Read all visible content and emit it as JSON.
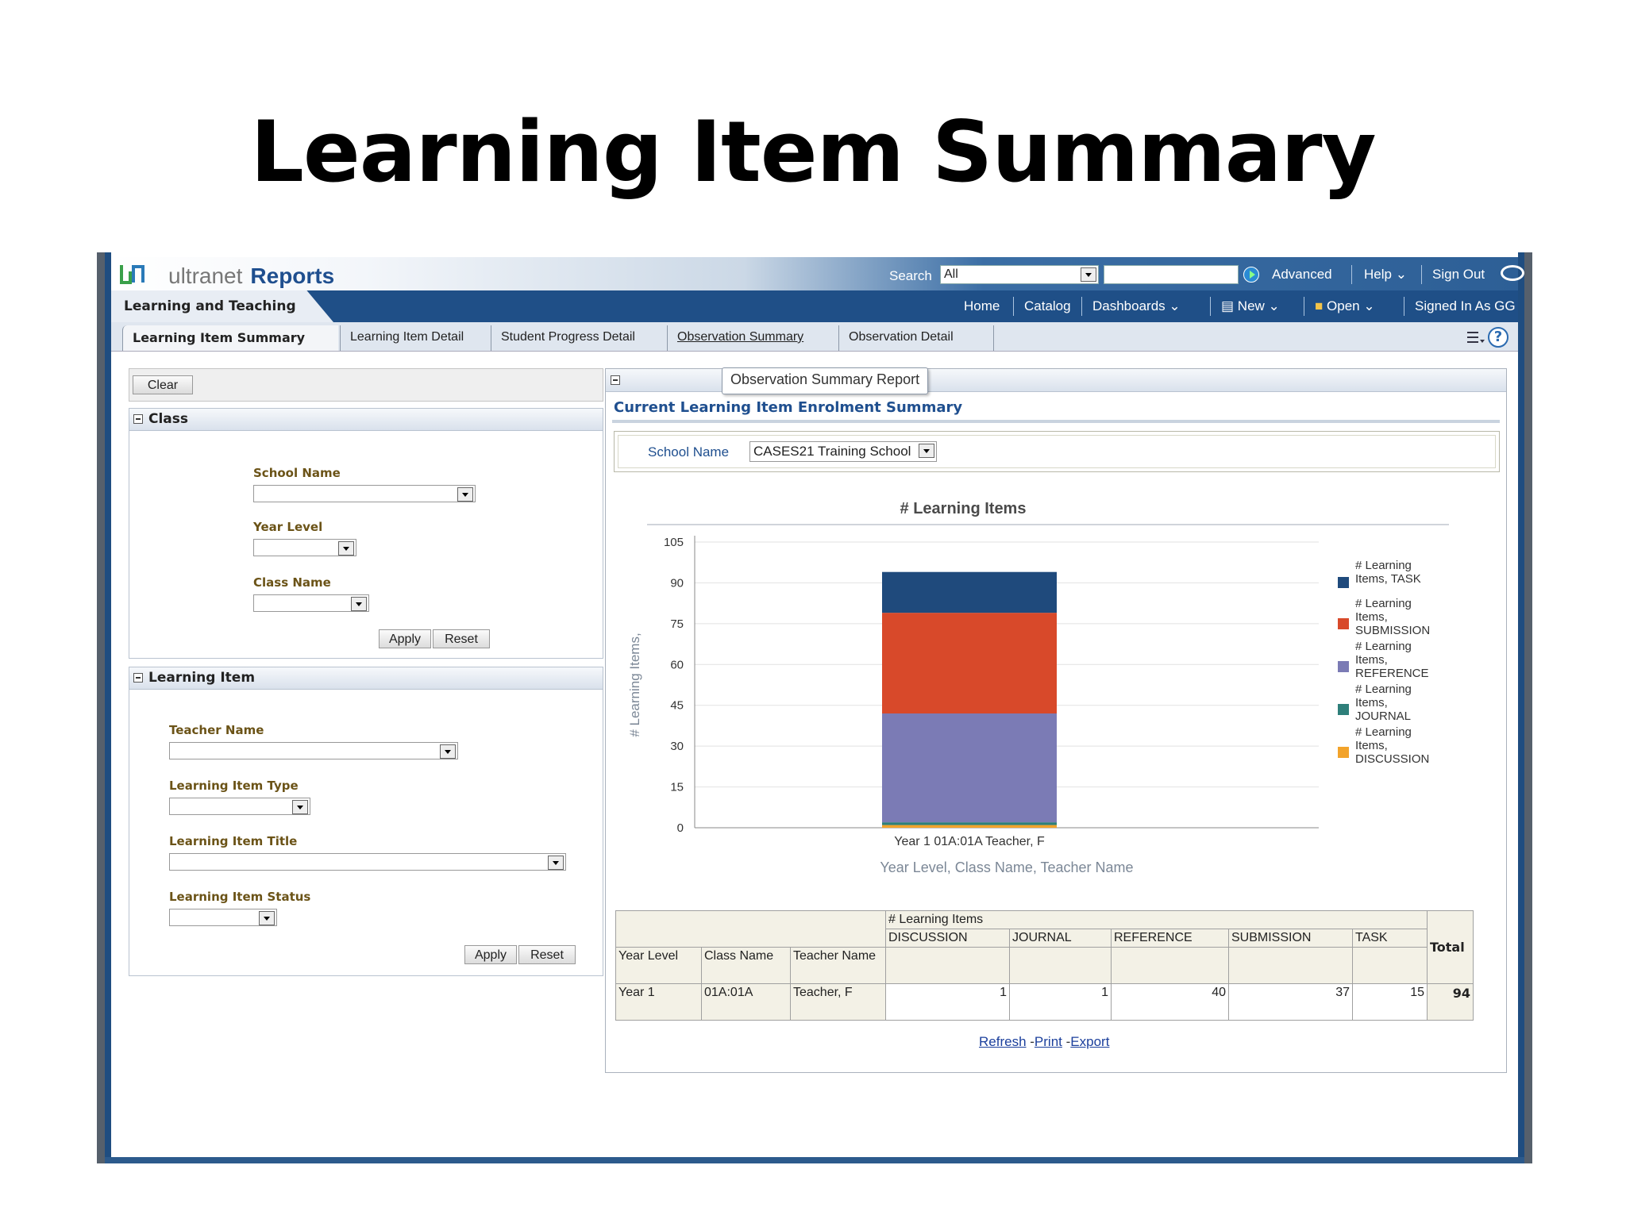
{
  "slide_title": "Learning Item Summary",
  "header": {
    "brand_light": "ultranet",
    "brand_bold": "Reports",
    "search_label": "Search",
    "search_scope": "All",
    "advanced": "Advanced",
    "help": "Help",
    "sign_out": "Sign Out",
    "section": "Learning and Teaching",
    "nav": {
      "home": "Home",
      "catalog": "Catalog",
      "dashboards": "Dashboards",
      "new": "New",
      "open": "Open",
      "signed_in": "Signed In As  GG"
    }
  },
  "tabs": [
    "Learning Item Summary",
    "Learning Item Detail",
    "Student Progress Detail",
    "Observation Summary",
    "Observation Detail"
  ],
  "left": {
    "clear": "Clear",
    "class_group": {
      "title": "Class",
      "school_name": "School Name",
      "year_level": "Year Level",
      "class_name": "Class Name",
      "apply": "Apply",
      "reset": "Reset"
    },
    "item_group": {
      "title": "Learning Item",
      "teacher_name": "Teacher Name",
      "item_type": "Learning Item Type",
      "item_title": "Learning Item Title",
      "item_status": "Learning Item Status",
      "apply": "Apply",
      "reset": "Reset"
    }
  },
  "report": {
    "tab": "Observation Summary Report",
    "title": "Current Learning Item Enrolment Summary",
    "school_label": "School Name",
    "school_value": "CASES21 Training School",
    "links": {
      "refresh": "Refresh",
      "print": "Print",
      "export": "Export"
    }
  },
  "chart_data": {
    "type": "bar",
    "stacked": true,
    "title": "# Learning Items",
    "xlabel": "Year Level, Class Name, Teacher Name",
    "ylabel": "# Learning Items,",
    "ylim": [
      0,
      105
    ],
    "yticks": [
      0,
      15,
      30,
      45,
      60,
      75,
      90,
      105
    ],
    "categories": [
      "Year 1 01A:01A Teacher, F"
    ],
    "series": [
      {
        "name": "# Learning Items, DISCUSSION",
        "values": [
          1
        ],
        "color": "#f2a32b"
      },
      {
        "name": "# Learning Items, JOURNAL",
        "values": [
          1
        ],
        "color": "#2e7f7a"
      },
      {
        "name": "# Learning Items, REFERENCE",
        "values": [
          40
        ],
        "color": "#7b7bb5"
      },
      {
        "name": "# Learning Items, SUBMISSION",
        "values": [
          37
        ],
        "color": "#d8492a"
      },
      {
        "name": "# Learning Items, TASK",
        "values": [
          15
        ],
        "color": "#1f4a7c"
      }
    ],
    "legend_order": [
      "TASK",
      "SUBMISSION",
      "REFERENCE",
      "JOURNAL",
      "DISCUSSION"
    ],
    "legend_position": "right",
    "grid": true
  },
  "table": {
    "measure": "# Learning Items",
    "total_label": "Total",
    "columns": [
      "DISCUSSION",
      "JOURNAL",
      "REFERENCE",
      "SUBMISSION",
      "TASK"
    ],
    "row_headers": [
      "Year Level",
      "Class Name",
      "Teacher Name"
    ],
    "rows": [
      {
        "year": "Year 1",
        "class": "01A:01A",
        "teacher": "Teacher, F",
        "values": [
          "1",
          "1",
          "40",
          "37",
          "15"
        ],
        "total": "94"
      }
    ]
  }
}
